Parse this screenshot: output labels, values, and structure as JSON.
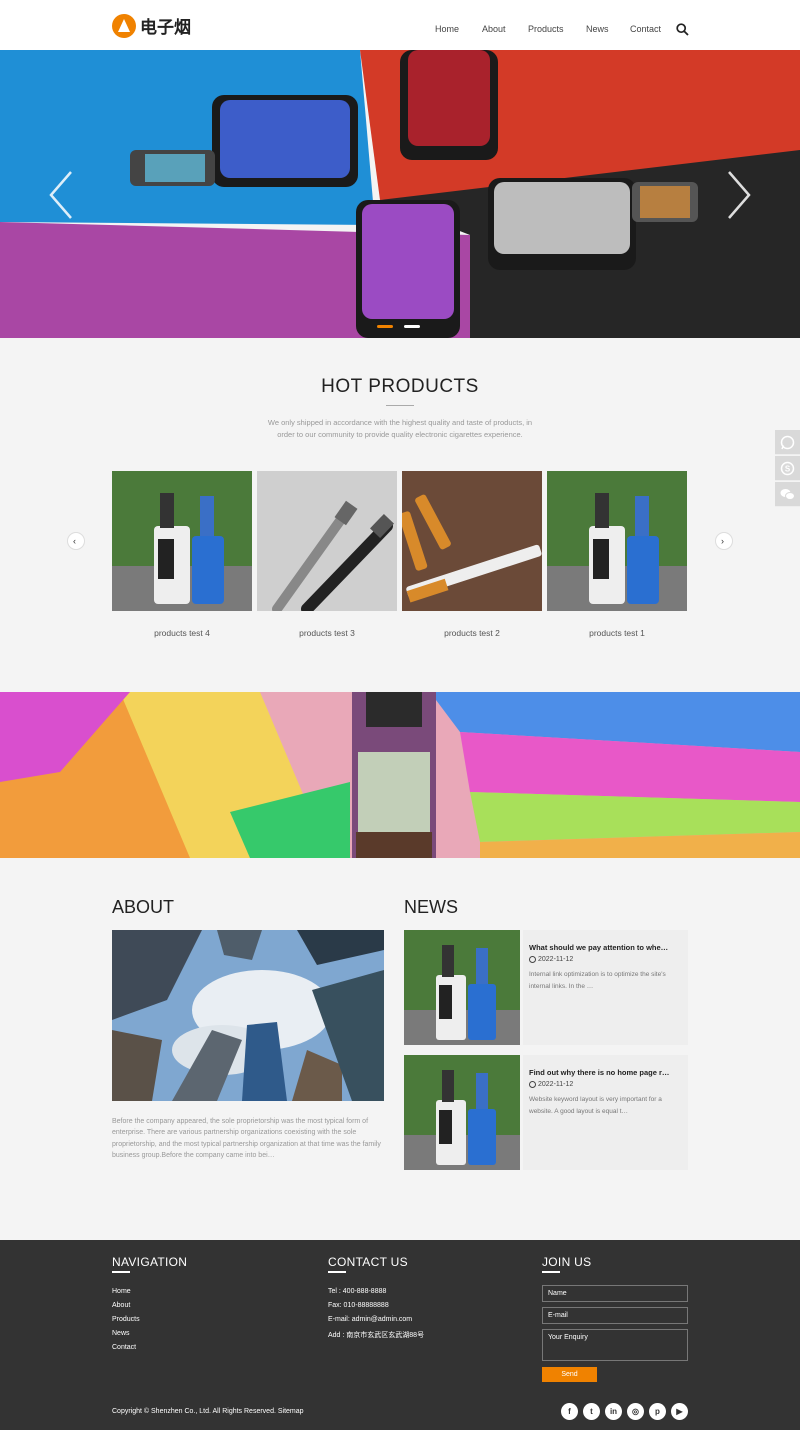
{
  "brand": {
    "logo_text": "电子烟",
    "accent": "#f08200"
  },
  "nav": [
    "Home",
    "About",
    "Products",
    "News",
    "Contact"
  ],
  "hot": {
    "title": "HOT PRODUCTS",
    "desc": "We only shipped in accordance with the highest quality and taste of products, in order to our community to provide quality electronic cigarettes experience.",
    "products": [
      "products test 4",
      "products test 3",
      "products test 2",
      "products test 1"
    ]
  },
  "about": {
    "title": "ABOUT",
    "text": "Before the company appeared, the sole proprietorship was the most typical form of enterprise. There are various partnership organizations coexisting with the sole proprietorship, and the most typical partnership organization at that time was the family business group.Before the company came into bei…"
  },
  "news": {
    "title": "NEWS",
    "items": [
      {
        "title": "What should we pay attention to whe…",
        "date": "2022-11-12",
        "excerpt": "Internal link optimization is to optimize the site's internal links. In the …"
      },
      {
        "title": "Find out why there is no home page r…",
        "date": "2022-11-12",
        "excerpt": "Website keyword layout is very important for a website. A good layout is equal t…"
      }
    ]
  },
  "footer": {
    "nav_title": "NAVIGATION",
    "nav_links": [
      "Home",
      "About",
      "Products",
      "News",
      "Contact"
    ],
    "contact_title": "CONTACT US",
    "contact": [
      "Tel : 400-888-8888",
      "Fax: 010-88888888",
      "E-mail: admin@admin.com",
      "Add : 南京市玄武区玄武湖88号"
    ],
    "join_title": "JOIN US",
    "fields": [
      "Name",
      "E-mail",
      "Your Enquiry"
    ],
    "send": "Send",
    "copyright": "Copyright © Shenzhen Co., Ltd. All Rights Reserved. Sitemap",
    "social": [
      "facebook-icon",
      "twitter-icon",
      "linkedin-icon",
      "instagram-icon",
      "pinterest-icon",
      "youtube-icon"
    ]
  },
  "side_icons": [
    "whatsapp-icon",
    "skype-icon",
    "wechat-icon"
  ]
}
